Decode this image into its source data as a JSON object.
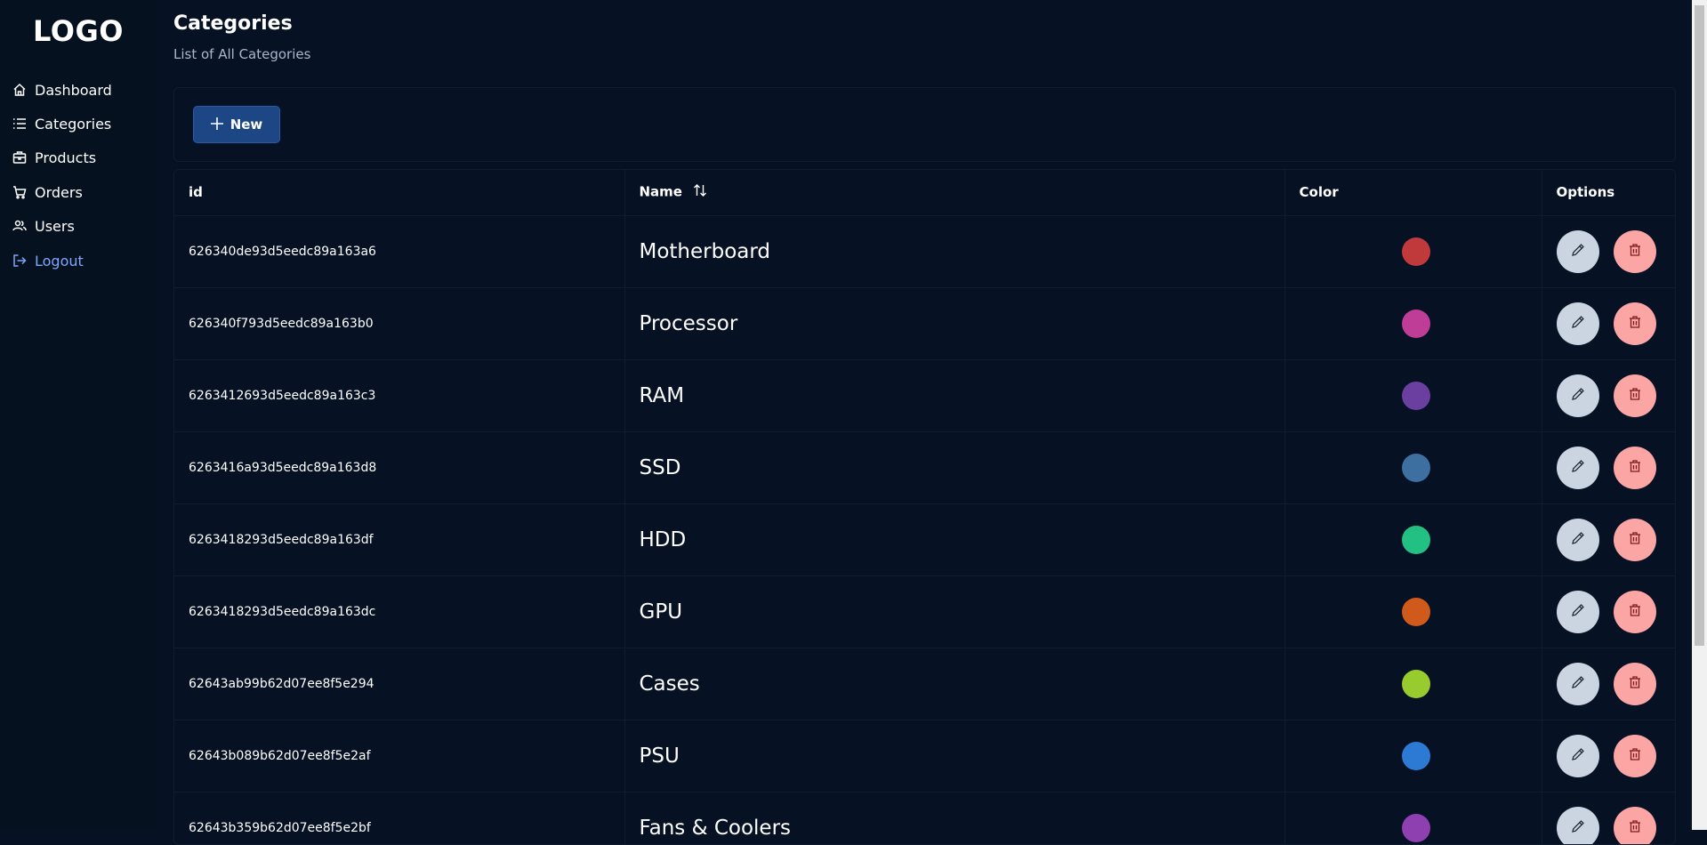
{
  "sidebar": {
    "logo": "LOGO",
    "items": [
      {
        "label": "Dashboard",
        "icon": "home-icon"
      },
      {
        "label": "Categories",
        "icon": "list-icon"
      },
      {
        "label": "Products",
        "icon": "box-icon"
      },
      {
        "label": "Orders",
        "icon": "cart-icon"
      },
      {
        "label": "Users",
        "icon": "users-icon"
      },
      {
        "label": "Logout",
        "icon": "sign-out-icon"
      }
    ]
  },
  "header": {
    "title": "Categories",
    "subtitle": "List of All Categories"
  },
  "toolbar": {
    "new_label": "New"
  },
  "table": {
    "columns": [
      "id",
      "Name",
      "Color",
      "Options"
    ],
    "rows": [
      {
        "id": "626340de93d5eedc89a163a6",
        "name": "Motherboard",
        "color": "#c0393b"
      },
      {
        "id": "626340f793d5eedc89a163b0",
        "name": "Processor",
        "color": "#bf3c97"
      },
      {
        "id": "6263412693d5eedc89a163c3",
        "name": "RAM",
        "color": "#6a3fa0"
      },
      {
        "id": "6263416a93d5eedc89a163d8",
        "name": "SSD",
        "color": "#3d6fa0"
      },
      {
        "id": "6263418293d5eedc89a163df",
        "name": "HDD",
        "color": "#22c083"
      },
      {
        "id": "6263418293d5eedc89a163dc",
        "name": "GPU",
        "color": "#cf5a1c"
      },
      {
        "id": "62643ab99b62d07ee8f5e294",
        "name": "Cases",
        "color": "#98cc2e"
      },
      {
        "id": "62643b089b62d07ee8f5e2af",
        "name": "PSU",
        "color": "#2d7ad4"
      },
      {
        "id": "62643b359b62d07ee8f5e2bf",
        "name": "Fans & Coolers",
        "color": "#8e3fb0"
      }
    ]
  }
}
